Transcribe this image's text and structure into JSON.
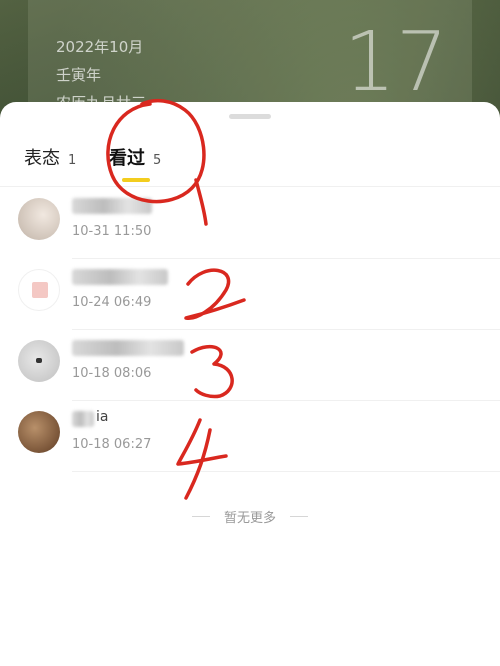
{
  "background": {
    "date_line1": "2022年10月",
    "date_line2": "壬寅年",
    "date_line3": "农历九月廿三",
    "day": "17"
  },
  "sheet": {
    "tabs": [
      {
        "label": "表态",
        "count": "1",
        "active": false
      },
      {
        "label": "看过",
        "count": "5",
        "active": true
      }
    ],
    "viewers": [
      {
        "name_visible": "",
        "time": "10-31 11:50"
      },
      {
        "name_visible": "",
        "time": "10-24 06:49"
      },
      {
        "name_visible": "",
        "time": "10-18 08:06"
      },
      {
        "name_visible": "ia",
        "time": "10-18 06:27"
      }
    ],
    "footer_text": "暂无更多"
  },
  "colors": {
    "accent_underline": "#f3cd1e",
    "annotation_red": "#d9281f"
  }
}
